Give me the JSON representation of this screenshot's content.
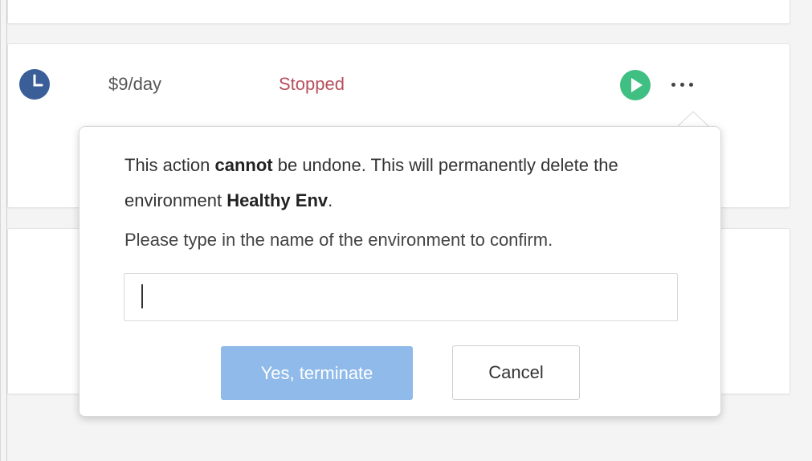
{
  "row": {
    "price": "$9/day",
    "status": "Stopped",
    "icons": {
      "schedule": "clock-icon",
      "start": "play-icon",
      "menu": "more-icon"
    },
    "colors": {
      "clock": "#3a5e98",
      "play": "#3fbf82",
      "status": "#b7505c"
    }
  },
  "dialog": {
    "message_part1": "This action ",
    "message_bold1": "cannot",
    "message_part2": " be undone. This will permanently delete the environment ",
    "message_bold2": "Healthy Env",
    "message_part3": ".",
    "prompt": "Please type in the name of the environment to confirm.",
    "input_value": "",
    "confirm_label": "Yes, terminate",
    "cancel_label": "Cancel",
    "confirm_color": "#8fbaea"
  }
}
